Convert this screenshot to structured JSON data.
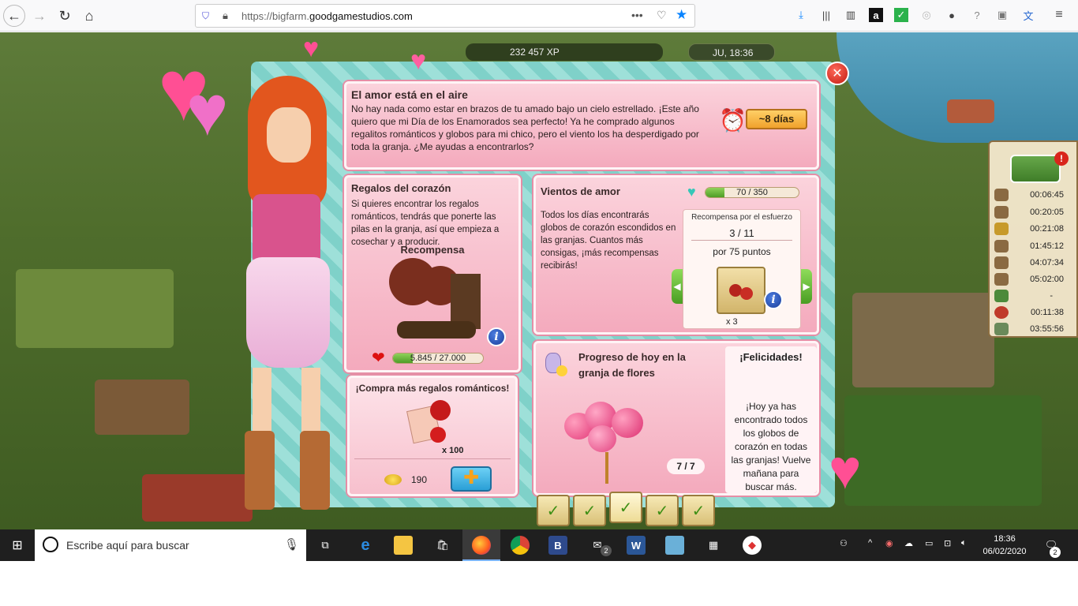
{
  "browser": {
    "url_prefix": "https://bigfarm.",
    "url_domain": "goodgamestudios.com",
    "more": "•••"
  },
  "hud": {
    "datetime": "JU, 18:36",
    "xp_partial": "232 457 XP"
  },
  "header": {
    "title": "El amor está en el aire",
    "text": "No hay nada como estar en brazos de tu amado bajo un cielo estrellado. ¡Este año quiero que mi Día de los Enamorados sea perfecto! Ya he comprado algunos regalitos románticos y globos para mi chico, pero el viento los ha desperdigado por toda la granja. ¿Me ayudas a encontrarlos?",
    "time_left": "~8 días"
  },
  "regalos": {
    "title": "Regalos del corazón",
    "text": "Si quieres encontrar los regalos románticos, tendrás que ponerte las pilas en la granja, así que empieza a cosechar y a producir.",
    "reward_label": "Recompensa",
    "progress_label": "5.845 / 27.000",
    "progress_fraction": 0.2165
  },
  "compra": {
    "title": "¡Compra más regalos románticos!",
    "item_count": "x 100",
    "price": "190"
  },
  "vientos": {
    "title": "Vientos de amor",
    "progress_label": "70 / 350",
    "progress_fraction": 0.2,
    "text": "Todos los días encontrarás globos de corazón escondidos en las granjas. Cuantos más consigas, ¡más recompensas recibirás!",
    "effort_title": "Recompensa por el esfuerzo",
    "effort_count": "3 / 11",
    "effort_points": "por 75 puntos",
    "effort_qty": "x 3"
  },
  "progreso": {
    "title": "Progreso de hoy en la granja de flores",
    "count": "7 / 7",
    "congrats_title": "¡Felicidades!",
    "congrats_text": "¡Hoy ya has encontrado todos los globos de corazón en todas las granjas! Vuelve mañana para buscar más."
  },
  "timers": [
    "00:06:45",
    "00:20:05",
    "00:21:08",
    "01:45:12",
    "04:07:34",
    "05:02:00",
    "-",
    "00:11:38",
    "03:55:56"
  ],
  "taskbar": {
    "search_placeholder": "Escribe aquí para buscar",
    "mail_badge": "2",
    "time": "18:36",
    "date": "06/02/2020",
    "notif_badge": "2"
  }
}
